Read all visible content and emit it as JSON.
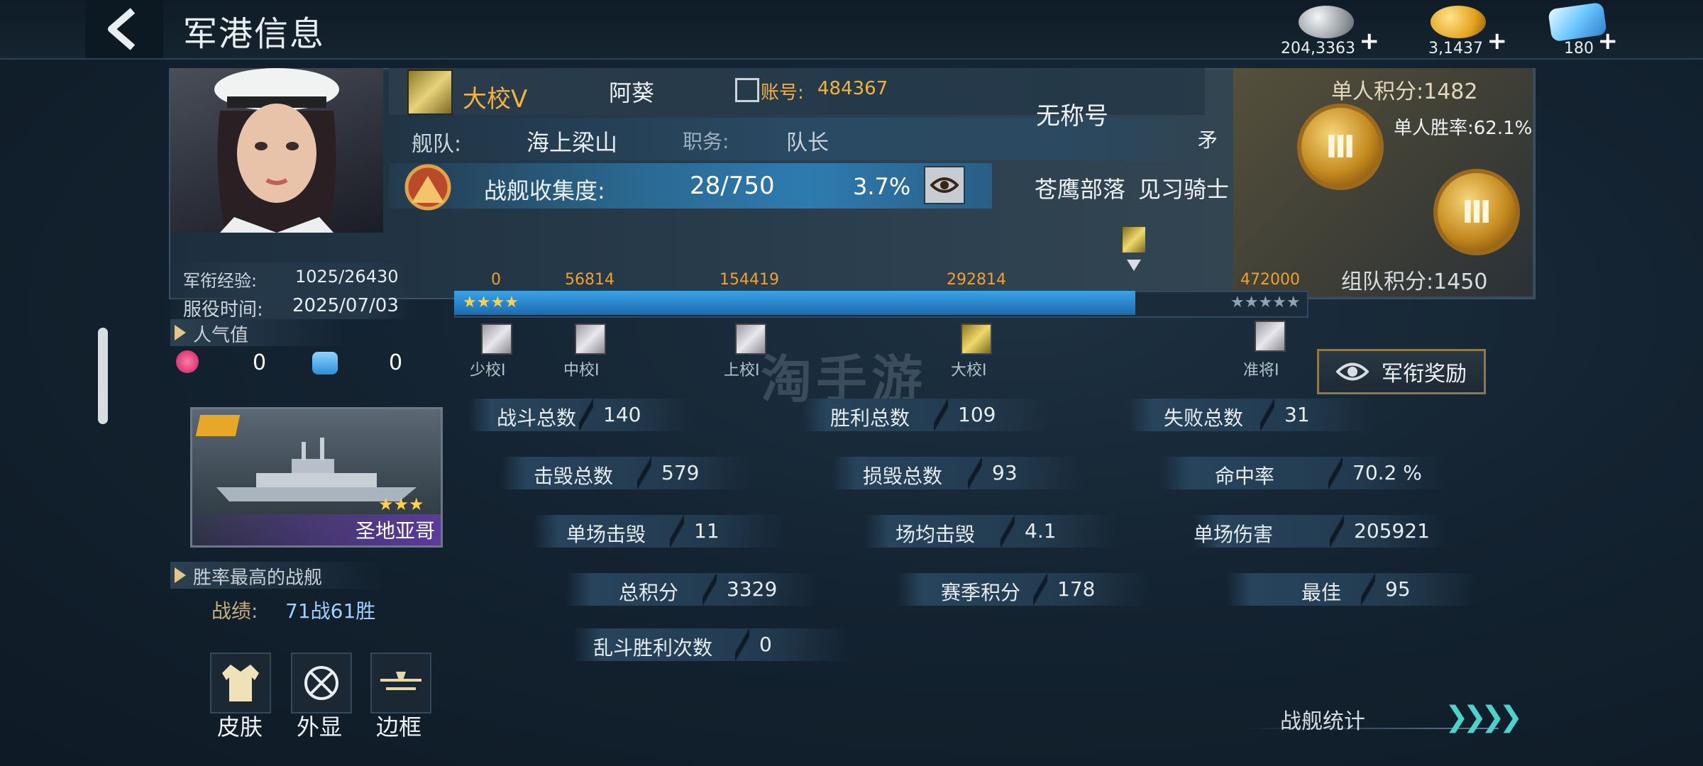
{
  "header": {
    "title": "军港信息"
  },
  "currencies": [
    {
      "icon": "silver-coin-icon",
      "value": "204,3363",
      "color": "#c8ccd0"
    },
    {
      "icon": "gold-coin-icon",
      "value": "3,1437",
      "color": "#f1b42f"
    },
    {
      "icon": "diamond-icon",
      "value": "180",
      "color": "#7fd0ff"
    }
  ],
  "profile": {
    "rank": "大校Ⅴ",
    "name": "阿葵",
    "account_label": "账号:",
    "account": "484367",
    "title": "无称号",
    "fleet_label": "舰队:",
    "fleet": "海上梁山",
    "duty_label": "职务:",
    "duty": "队长",
    "collect_label": "战舰收集度:",
    "collect_value": "28/750",
    "collect_percent": "3.7%",
    "clan": "苍鹰部落",
    "clan_rank": "见习骑士",
    "clipped_char": "矛",
    "solo_score": "单人积分:1482",
    "solo_winrate": "单人胜率:62.1%",
    "team_score": "组队积分:1450",
    "medal_tier": "Ⅲ"
  },
  "exp": {
    "label": "军衔经验:",
    "value": "1025/26430",
    "service_label": "服役时间:",
    "service_date": "2025/07/03",
    "progress": 0.8,
    "ticks": [
      "0",
      "56814",
      "154419",
      "292814",
      "472000"
    ],
    "ranks": [
      "少校Ⅰ",
      "中校Ⅰ",
      "上校Ⅰ",
      "大校Ⅰ",
      "准将Ⅰ"
    ],
    "reward_button": "军衔奖励"
  },
  "popularity": {
    "label": "人气值",
    "rose_count": "0",
    "slipper_count": "0"
  },
  "stats": [
    {
      "k": "战斗总数",
      "v": "140"
    },
    {
      "k": "胜利总数",
      "v": "109"
    },
    {
      "k": "失败总数",
      "v": "31"
    },
    {
      "k": "击毁总数",
      "v": "579"
    },
    {
      "k": "损毁总数",
      "v": "93"
    },
    {
      "k": "命中率",
      "v": "70.2 %"
    },
    {
      "k": "单场击毁",
      "v": "11"
    },
    {
      "k": "场均击毁",
      "v": "4.1"
    },
    {
      "k": "单场伤害",
      "v": "205921"
    },
    {
      "k": "总积分",
      "v": "3329"
    },
    {
      "k": "赛季积分",
      "v": "178"
    },
    {
      "k": "最佳",
      "v": "95"
    },
    {
      "k": "乱斗胜利次数",
      "v": "0"
    }
  ],
  "ship": {
    "name": "圣地亚哥",
    "stars": "★★★",
    "best_label": "胜率最高的战舰",
    "record_label": "战绩:",
    "record": "71战61胜"
  },
  "tiles": [
    {
      "label": "皮肤",
      "icon": "jacket-icon"
    },
    {
      "label": "外显",
      "icon": "crosshair-icon"
    },
    {
      "label": "边框",
      "icon": "frame-icon"
    }
  ],
  "footer": {
    "ship_stats": "战舰统计",
    "watermark": "淘手游"
  }
}
